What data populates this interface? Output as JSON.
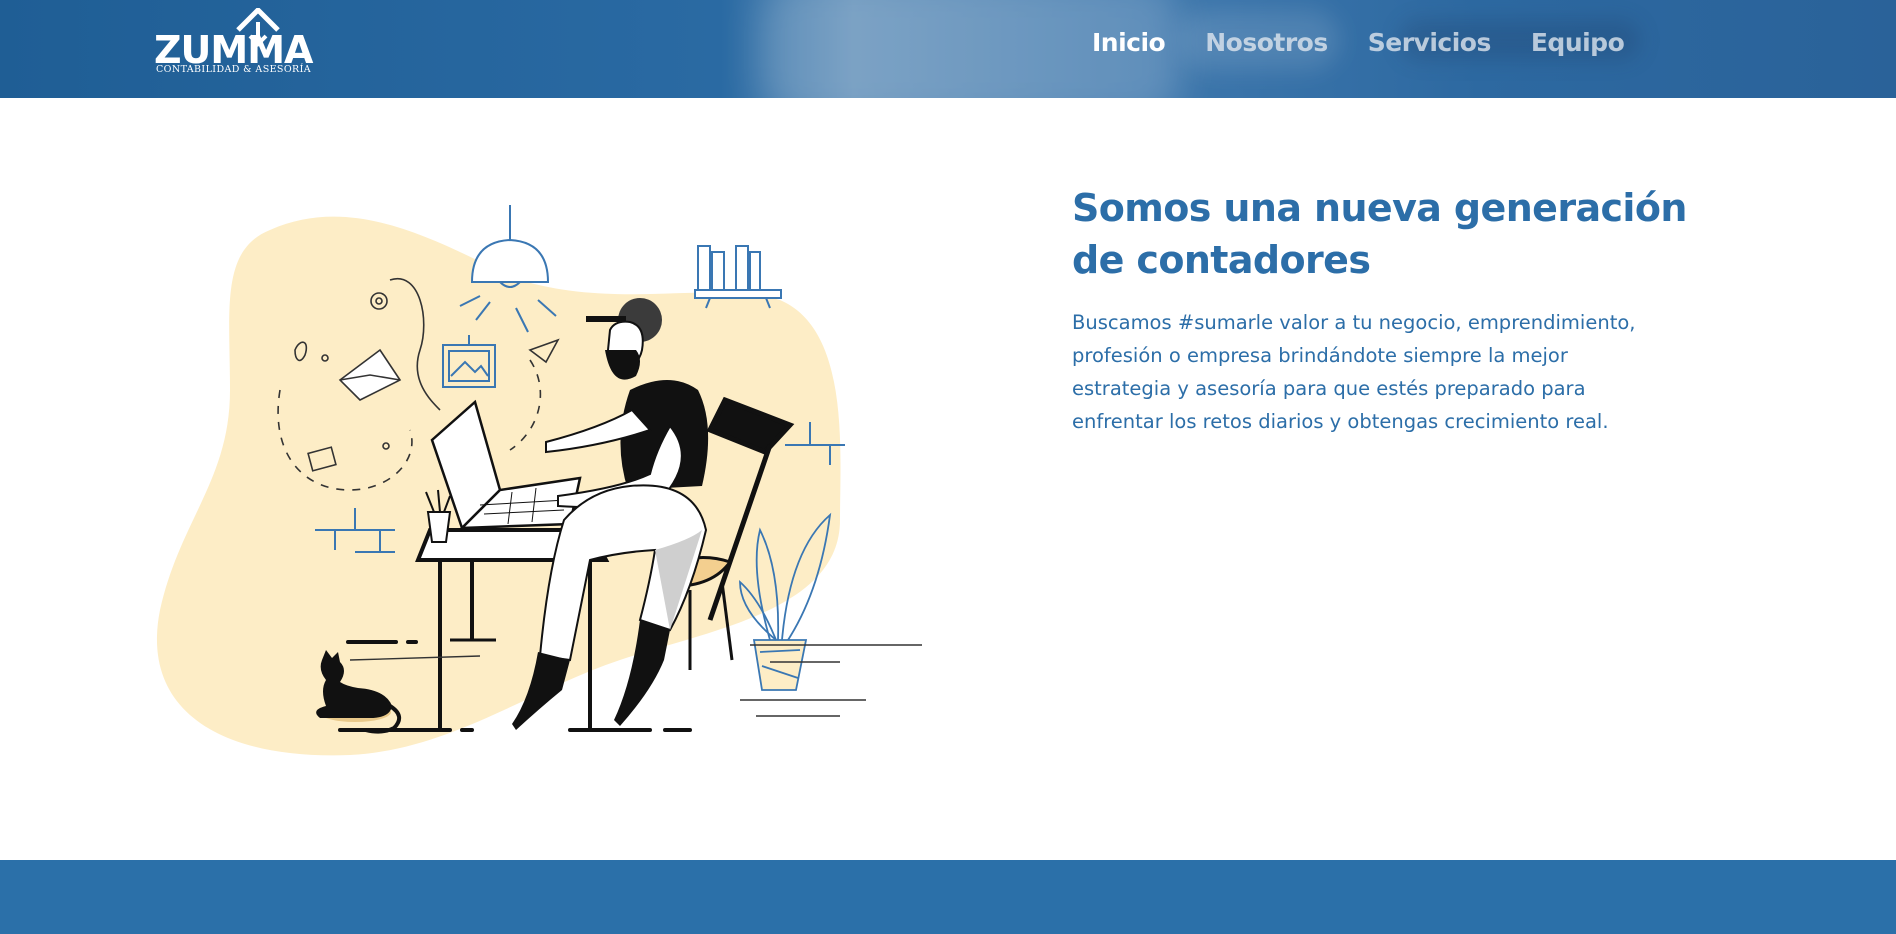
{
  "brand": {
    "name": "ZUMMA",
    "tagline": "CONTABILIDAD & ASESORÍA"
  },
  "nav": {
    "items": [
      "Inicio",
      "Nosotros",
      "Servicios",
      "Equipo"
    ],
    "active": "Inicio"
  },
  "hero": {
    "title": "Somos una nueva generación de contadores",
    "description": "Buscamos #sumarle valor a tu negocio, emprendimiento, profesión o empresa brindándote siempre la mejor estrategia y asesoría para que estés preparado para enfrentar los retos diarios y obtengas crecimiento real."
  },
  "colors": {
    "primary": "#2c6ea8",
    "header": "#2a6aa3",
    "blob": "#fdedc6",
    "footer": "#2b70a9"
  }
}
